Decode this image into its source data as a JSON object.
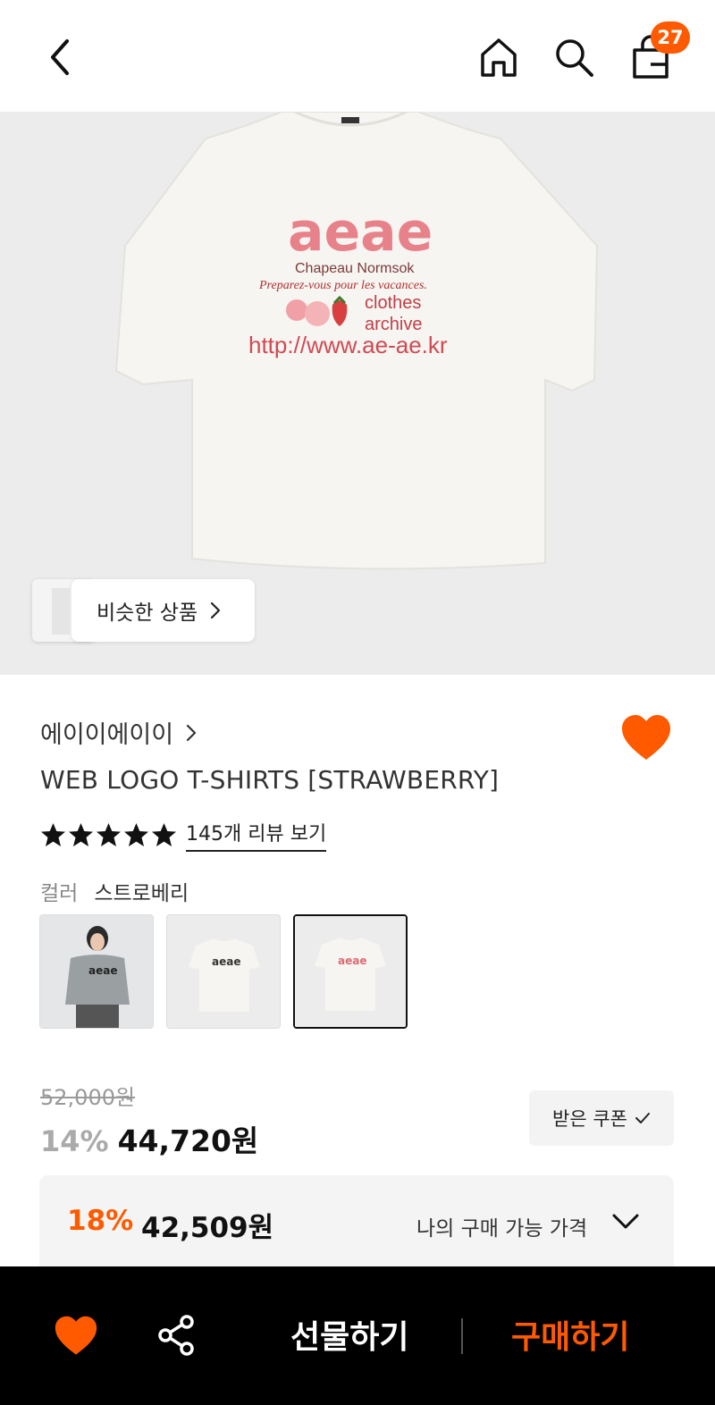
{
  "header": {
    "cart_count": "27"
  },
  "hero": {
    "tee_print": {
      "logo": "aeae",
      "line1": "Chapeau Normsok",
      "line2": "Preparez-vous pour les vacances.",
      "line3a": "clothes",
      "line3b": "archive",
      "url": "http://www.ae-ae.kr"
    },
    "similar_label": "비슷한 상품"
  },
  "product": {
    "brand": "에이이에이이",
    "title": "WEB LOGO T-SHIRTS [STRAWBERRY]",
    "rating_stars": 5,
    "review_link": "145개 리뷰 보기",
    "color_label": "컬러",
    "color_value": "스트로베리",
    "swatches": [
      {
        "print": "aeae"
      },
      {
        "print": "aeae"
      },
      {
        "print": "aeae"
      }
    ]
  },
  "pricing": {
    "original": "52,000원",
    "discount": "14%",
    "price": "44,720원",
    "coupon_label": "받은 쿠폰",
    "my_discount": "18%",
    "my_price": "42,509원",
    "my_label": "나의 구매 가능 가격"
  },
  "bottom_bar": {
    "gift_label": "선물하기",
    "buy_label": "구매하기"
  },
  "colors": {
    "accent": "#ff5a00",
    "bar_bg": "#000000",
    "hero_bg": "#ececec"
  }
}
